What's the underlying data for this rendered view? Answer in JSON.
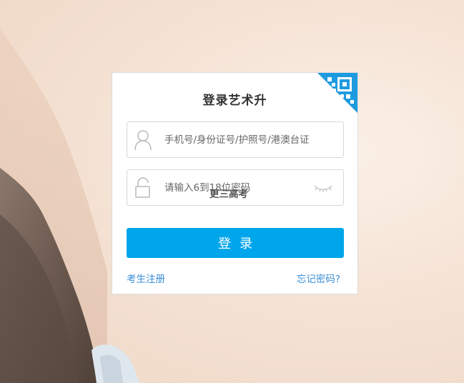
{
  "login": {
    "title": "登录艺术升",
    "username": {
      "icon": "user-icon",
      "placeholder": "手机号/身份证号/护照号/港澳台证",
      "value": ""
    },
    "password": {
      "icon": "lock-icon",
      "placeholder": "请输入6到18位密码",
      "value": "",
      "toggle_icon": "eye-closed-icon"
    },
    "overlay_text": "更三高考",
    "submit_label": "登录",
    "register_link": "考生注册",
    "forgot_link": "忘记密码?",
    "qr_icon": "qr-code-icon"
  },
  "colors": {
    "accent": "#00a6ec",
    "link": "#3a8fd9",
    "title": "#333333",
    "qr": "#1e9be0"
  }
}
